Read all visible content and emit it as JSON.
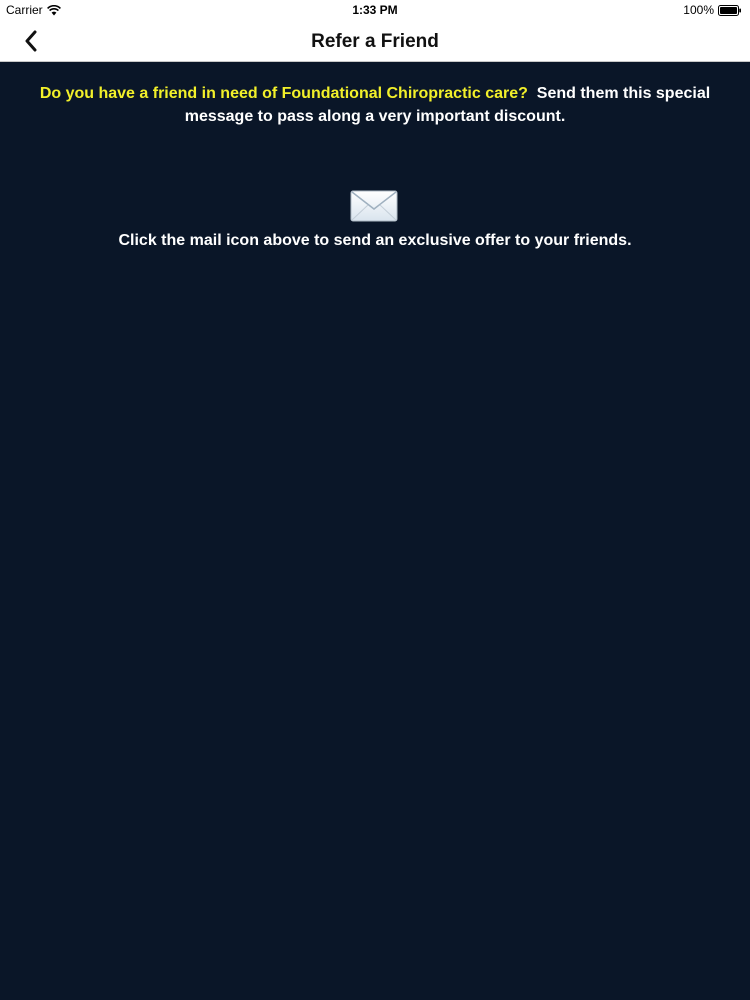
{
  "status_bar": {
    "carrier": "Carrier",
    "time": "1:33 PM",
    "battery": "100%",
    "icons": [
      "wifi-icon",
      "battery-icon"
    ]
  },
  "nav": {
    "title": "Refer a Friend",
    "back_icon": "chevron-left-icon"
  },
  "content": {
    "question": "Do you have a friend in need of Foundational Chiropractic care?",
    "message": "Send them this special message to pass along a very important discount.",
    "mail_icon": "envelope-icon",
    "instruction": "Click the mail icon above to send an exclusive offer to your friends."
  },
  "colors": {
    "background": "#0a1628",
    "highlight": "#f2f02a",
    "text": "#ffffff",
    "bar": "#ffffff"
  }
}
